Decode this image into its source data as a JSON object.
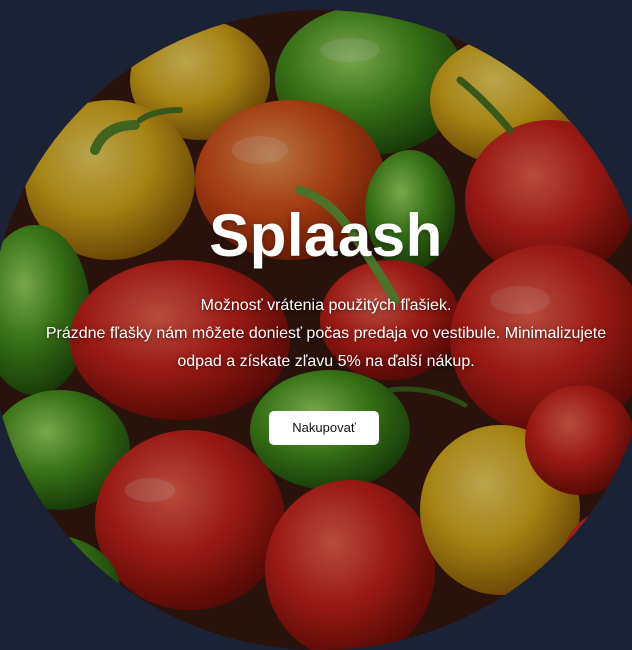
{
  "hero": {
    "title": "Splaash",
    "line1": "Možnosť vrátenia použitých fľašiek.",
    "line2": "Prázdne fľašky nám môžete doniesť počas predaja vo vestibule. Minimalizujete",
    "line3": "odpad a získate zľavu 5% na ďalší nákup.",
    "button_label": "Nakupovať",
    "image_subject": "peppers-photo"
  },
  "colors": {
    "page_background": "#1c2235",
    "button_background": "#ffffff",
    "text": "#ffffff"
  }
}
